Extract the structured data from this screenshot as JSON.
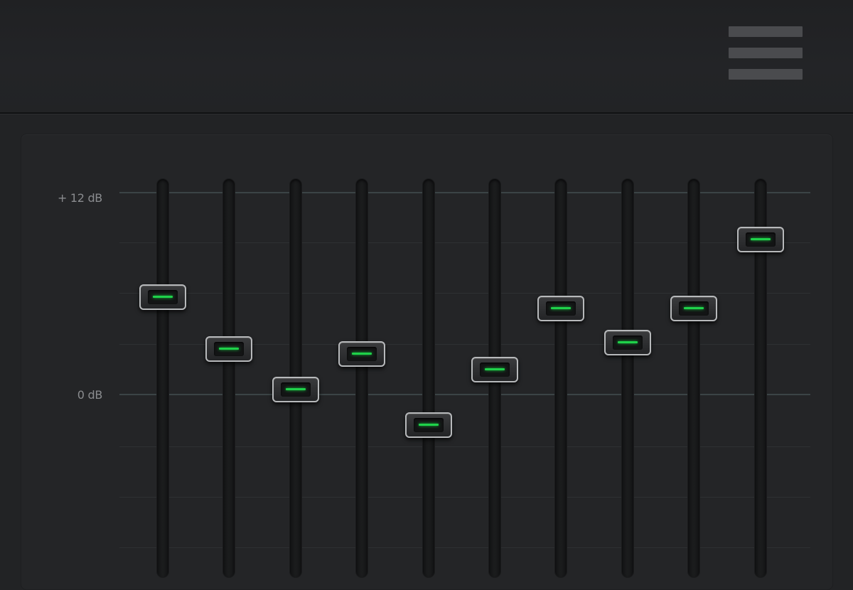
{
  "toolbar": {
    "menu_icon": "hamburger-menu-icon"
  },
  "equalizer": {
    "scale": {
      "max_label": "+ 12 dB",
      "zero_label": "0 dB",
      "max_db": 12,
      "min_db": -12
    },
    "accent_color": "#1fd24a",
    "band_gains_db": [
      5.8,
      2.7,
      0.3,
      2.4,
      -1.8,
      1.5,
      5.1,
      3.1,
      5.1,
      9.2
    ]
  }
}
